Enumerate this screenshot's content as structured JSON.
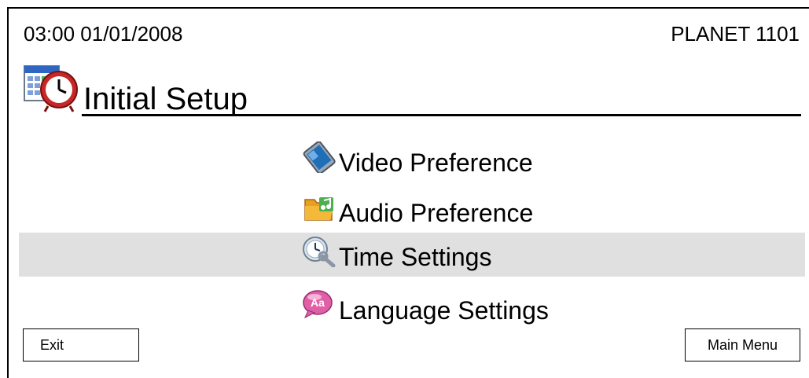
{
  "header": {
    "datetime": "03:00 01/01/2008",
    "device_name": "PLANET 1101"
  },
  "page": {
    "title": "Initial Setup",
    "title_icon": "calendar-clock-icon"
  },
  "menu": {
    "items": [
      {
        "label": "Video Preference",
        "icon": "video-tablet-icon",
        "selected": false
      },
      {
        "label": "Audio Preference",
        "icon": "music-folder-icon",
        "selected": false
      },
      {
        "label": "Time Settings",
        "icon": "clock-wrench-icon",
        "selected": true
      },
      {
        "label": "Language Settings",
        "icon": "language-bubble-icon",
        "selected": false
      }
    ],
    "selected_color": "#e0e0e0"
  },
  "buttons": {
    "exit_label": "Exit",
    "main_menu_label": "Main Menu"
  }
}
